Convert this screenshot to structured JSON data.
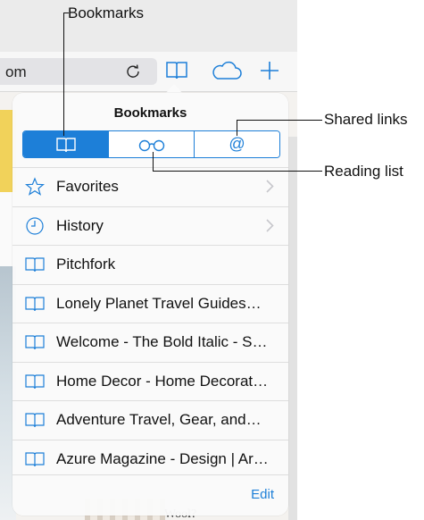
{
  "callouts": {
    "bookmarks": "Bookmarks",
    "shared_links": "Shared links",
    "reading_list": "Reading list"
  },
  "browser": {
    "address_text": "om",
    "bottom_text": "Wool?"
  },
  "popover": {
    "title": "Bookmarks",
    "tabs": [
      {
        "icon": "book-icon",
        "active": true
      },
      {
        "icon": "glasses-icon",
        "active": false
      },
      {
        "icon": "at-sign-icon",
        "active": false
      }
    ],
    "items": [
      {
        "icon": "star-icon",
        "label": "Favorites",
        "chevron": true
      },
      {
        "icon": "clock-icon",
        "label": "History",
        "chevron": true
      },
      {
        "icon": "book-icon",
        "label": "Pitchfork",
        "chevron": false
      },
      {
        "icon": "book-icon",
        "label": "Lonely Planet Travel Guides…",
        "chevron": false
      },
      {
        "icon": "book-icon",
        "label": "Welcome - The Bold Italic - S…",
        "chevron": false
      },
      {
        "icon": "book-icon",
        "label": "Home Decor - Home Decorat…",
        "chevron": false
      },
      {
        "icon": "book-icon",
        "label": "Adventure Travel, Gear, and…",
        "chevron": false
      },
      {
        "icon": "book-icon",
        "label": "Azure Magazine - Design | Ar…",
        "chevron": false
      }
    ],
    "edit_label": "Edit"
  },
  "colors": {
    "accent": "#1d7fd8"
  }
}
